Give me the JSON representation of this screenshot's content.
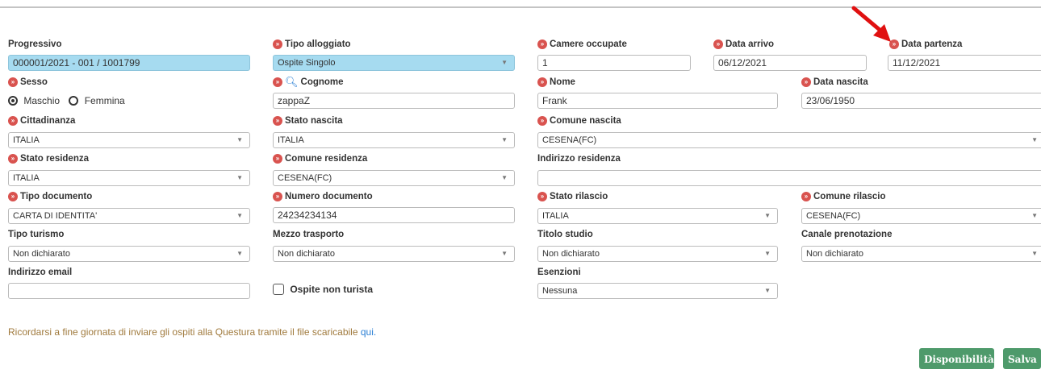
{
  "fields": {
    "progressivo": {
      "label": "Progressivo",
      "value": "000001/2021   - 001 / 1001799"
    },
    "tipo_alloggiato": {
      "label": "Tipo alloggiato",
      "value": "Ospite Singolo"
    },
    "camere_occupate": {
      "label": "Camere occupate",
      "value": "1"
    },
    "data_arrivo": {
      "label": "Data arrivo",
      "value": "06/12/2021"
    },
    "data_partenza": {
      "label": "Data partenza",
      "value": "11/12/2021"
    },
    "sesso": {
      "label": "Sesso",
      "option_male": "Maschio",
      "option_female": "Femmina",
      "selected": "Maschio"
    },
    "cognome": {
      "label": "Cognome",
      "value": "zappaZ"
    },
    "nome": {
      "label": "Nome",
      "value": "Frank"
    },
    "data_nascita": {
      "label": "Data nascita",
      "value": "23/06/1950"
    },
    "cittadinanza": {
      "label": "Cittadinanza",
      "value": "ITALIA"
    },
    "stato_nascita": {
      "label": "Stato nascita",
      "value": "ITALIA"
    },
    "comune_nascita": {
      "label": "Comune nascita",
      "value": "CESENA(FC)"
    },
    "stato_residenza": {
      "label": "Stato residenza",
      "value": "ITALIA"
    },
    "comune_residenza": {
      "label": "Comune residenza",
      "value": "CESENA(FC)"
    },
    "indirizzo_residenza": {
      "label": "Indirizzo residenza",
      "value": ""
    },
    "tipo_documento": {
      "label": "Tipo documento",
      "value": "CARTA DI IDENTITA'"
    },
    "numero_documento": {
      "label": "Numero documento",
      "value": "24234234134"
    },
    "stato_rilascio": {
      "label": "Stato rilascio",
      "value": "ITALIA"
    },
    "comune_rilascio": {
      "label": "Comune rilascio",
      "value": "CESENA(FC)"
    },
    "tipo_turismo": {
      "label": "Tipo turismo",
      "value": "Non dichiarato"
    },
    "mezzo_trasporto": {
      "label": "Mezzo trasporto",
      "value": "Non dichiarato"
    },
    "titolo_studio": {
      "label": "Titolo studio",
      "value": "Non dichiarato"
    },
    "canale_prenotazione": {
      "label": "Canale prenotazione",
      "value": "Non dichiarato"
    },
    "indirizzo_email": {
      "label": "Indirizzo email",
      "value": ""
    },
    "ospite_non_turista": {
      "label": "Ospite non turista",
      "checked": false
    },
    "esenzioni": {
      "label": "Esenzioni",
      "value": "Nessuna"
    }
  },
  "note": {
    "text": "Ricordarsi a fine giornata di inviare gli ospiti alla Questura tramite il file scaricabile ",
    "link": "qui."
  },
  "buttons": {
    "disponibilita": "Disponibilità",
    "salva": "Salva"
  },
  "icons": {
    "required": "required-chevron-icon",
    "search": "search-icon",
    "dropdown": "caret-down-icon",
    "annotation": "red-arrow-annotation"
  },
  "colors": {
    "highlight": "#a6dbf0",
    "required": "#d9534f",
    "button": "#4e9a6b",
    "note": "#a07a3d",
    "link": "#2a7fd4"
  }
}
